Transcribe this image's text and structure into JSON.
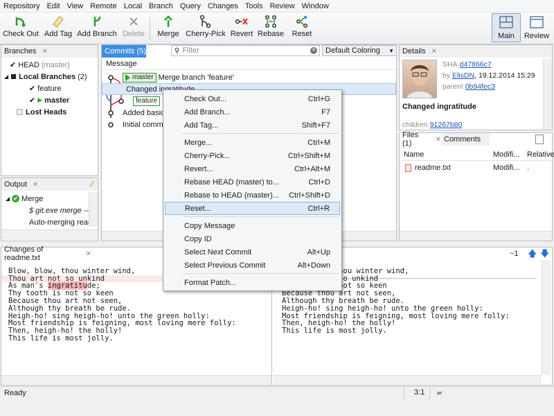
{
  "menu": [
    "Repository",
    "Edit",
    "View",
    "Remote",
    "Local",
    "Branch",
    "Query",
    "Changes",
    "Tools",
    "Review",
    "Window"
  ],
  "toolbar": {
    "checkout": "Check Out",
    "add_tag": "Add Tag",
    "add_branch": "Add Branch",
    "delete": "Delete",
    "merge": "Merge",
    "cherry_pick": "Cherry-Pick",
    "revert": "Revert",
    "rebase": "Rebase",
    "reset": "Reset",
    "main": "Main",
    "review": "Review"
  },
  "branches": {
    "tab": "Branches",
    "head": "HEAD",
    "head_suffix": "(master)",
    "local": "Local Branches",
    "local_count": "(2)",
    "feature": "feature",
    "master": "master",
    "lost_heads": "Lost Heads"
  },
  "output": {
    "tab": "Output",
    "merge": "Merge",
    "cmd": "$ git.exe merge --n",
    "auto": "Auto-merging reac"
  },
  "commits": {
    "tab": "Commits (5)",
    "filter_placeholder": "Filter",
    "coloring": "Default Coloring",
    "col_message": "Message",
    "rows": [
      {
        "tag": "master",
        "text": "Merge branch 'feature'"
      },
      {
        "tag": "",
        "text": "Changed ingratitude"
      },
      {
        "tag": "feature",
        "text": "C"
      },
      {
        "tag": "",
        "text": "Added basic"
      },
      {
        "tag": "",
        "text": "Initial comm"
      }
    ]
  },
  "context_menu": [
    {
      "label": "Check Out...",
      "shortcut": "Ctrl+G"
    },
    {
      "label": "Add Branch...",
      "shortcut": "F7"
    },
    {
      "label": "Add Tag...",
      "shortcut": "Shift+F7"
    },
    {
      "label": "Merge...",
      "shortcut": "Ctrl+M"
    },
    {
      "label": "Cherry-Pick...",
      "shortcut": "Ctrl+Shift+M"
    },
    {
      "label": "Revert...",
      "shortcut": "Ctrl+Alt+M"
    },
    {
      "label": "Rebase HEAD (master) to...",
      "shortcut": "Ctrl+D"
    },
    {
      "label": "Rebase to HEAD (master)...",
      "shortcut": "Ctrl+Shift+D"
    },
    {
      "label": "Reset...",
      "shortcut": "Ctrl+R"
    },
    {
      "label": "Copy Message",
      "shortcut": ""
    },
    {
      "label": "Copy ID",
      "shortcut": ""
    },
    {
      "label": "Select Next Commit",
      "shortcut": "Alt+Up"
    },
    {
      "label": "Select Previous Commit",
      "shortcut": "Alt+Down"
    },
    {
      "label": "Format Patch...",
      "shortcut": ""
    }
  ],
  "details": {
    "tab": "Details",
    "sha_label": "SHA",
    "sha": "d47866c7",
    "by_label": "by",
    "author": "ElisDN",
    "date": ", 19.12.2014 15:29",
    "parent_label": "parent",
    "parent": "0b94fec3",
    "message": "Changed ingratitude",
    "children_label": "children",
    "children": "91267b80"
  },
  "files": {
    "tab": "Files (1)",
    "comments_tab": "Comments",
    "col_name": "Name",
    "col_modified": "Modifi...",
    "col_relative": "Relative",
    "file_name": "readme.txt",
    "file_mod": "Modifi...",
    "file_rel": "."
  },
  "changes": {
    "tab": "Changes of readme.txt",
    "nav": "~1",
    "left_lines": [
      "Blow, blow, thou winter wind,",
      "Thou art not so unkind",
      "As man's ingratitude;",
      "Thy tooth is not so keen",
      "Because thou art not seen,",
      "Although thy breath be rude.",
      "Heigh-ho! sing heigh-ho! unto the green holly:",
      "Most friendship is feigning, most loving mere folly:",
      "Then, heigh-ho! the holly!",
      "This life is most jolly."
    ],
    "right_lines": [
      "Blow, blow, thou winter wind,",
      "Thou art not so unkind",
      "",
      "Thy tooth is not so keen",
      "Because thou art not seen,",
      "Although thy breath be rude.",
      "Heigh-ho! sing heigh-ho! unto the green holly:",
      "Most friendship is feigning, most loving mere folly:",
      "Then, heigh-ho! the holly!",
      "This life is most jolly."
    ],
    "highlight_prefix": "As man's ",
    "highlight_word": "ingratitu",
    "highlight_suffix": "de;"
  },
  "status": {
    "text": "Ready",
    "position": "3:1"
  },
  "colors": {
    "accent": "#3b8fe0",
    "highlight": "#dce9f8",
    "diff_removed": "#f5b6b6",
    "tag_green": "#2e9b2e"
  }
}
